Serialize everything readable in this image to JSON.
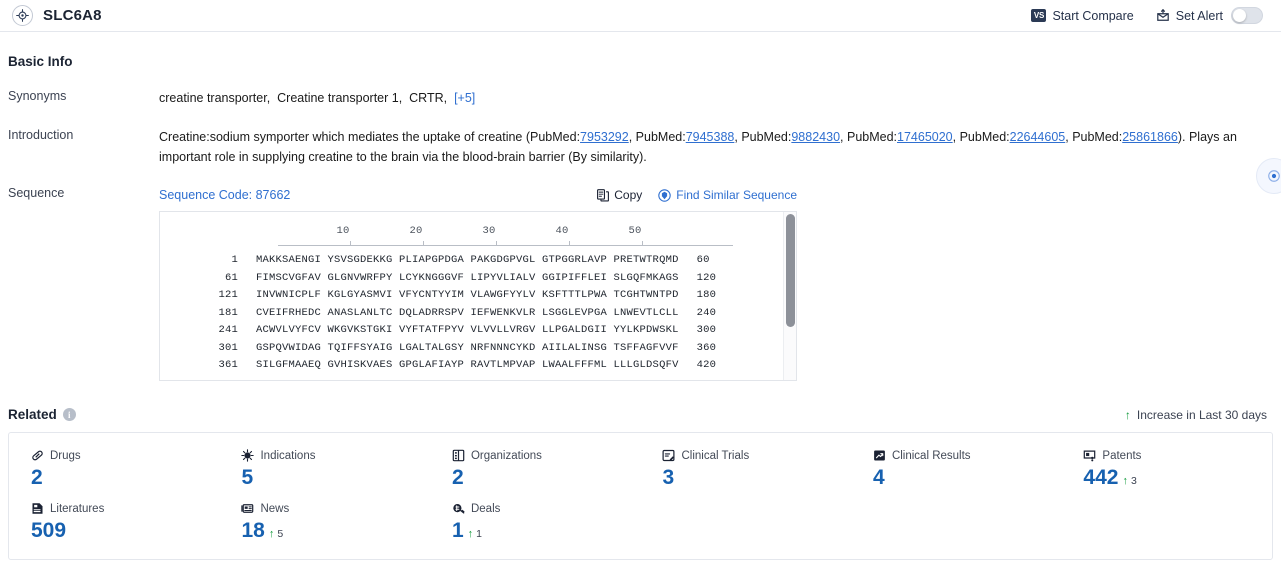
{
  "header": {
    "title": "SLC6A8",
    "logo_icon": "target-crosshair-icon",
    "start_compare": "Start Compare",
    "compare_badge": "VS",
    "set_alert": "Set Alert"
  },
  "basic_info": {
    "title": "Basic Info",
    "synonyms": {
      "label": "Synonyms",
      "items": [
        "creatine transporter,",
        "Creatine transporter 1,",
        "CRTR,"
      ],
      "more": "[+5]"
    },
    "introduction": {
      "label": "Introduction",
      "text_1": "Creatine:sodium symporter which mediates the uptake of creatine (PubMed:",
      "links": [
        "7953292",
        "7945388",
        "9882430",
        "17465020",
        "22644605",
        "25861866"
      ],
      "separator": ", PubMed:",
      "text_2": "). Plays an important role in supplying creatine to the brain via the blood-brain barrier (By similarity)."
    },
    "sequence": {
      "label": "Sequence",
      "code_label": "Sequence Code: 87662",
      "copy_label": "Copy",
      "find_similar_label": "Find Similar Sequence",
      "ruler_ticks": [
        10,
        20,
        30,
        40,
        50
      ],
      "rows": [
        {
          "start": "1",
          "blocks": "MAKKSAENGI YSVSGDEKKG PLIAPGPDGA PAKGDGPVGL GTPGGRLAVP PRETWTRQMD",
          "end": "60"
        },
        {
          "start": "61",
          "blocks": "FIMSCVGFAV GLGNVWRFPY LCYKNGGGVF LIPYVLIALV GGIPIFFLEI SLGQFMKAGS",
          "end": "120"
        },
        {
          "start": "121",
          "blocks": "INVWNICPLF KGLGYASMVI VFYCNTYYIM VLAWGFYYLV KSFTTTLPWA TCGHTWNTPD",
          "end": "180"
        },
        {
          "start": "181",
          "blocks": "CVEIFRHEDC ANASLANLTC DQLADRRSPV IEFWENKVLR LSGGLEVPGA LNWEVTLCLL",
          "end": "240"
        },
        {
          "start": "241",
          "blocks": "ACWVLVYFCV WKGVKSTGKI VYFTATFPYV VLVVLLVRGV LLPGALDGII YYLKPDWSKL",
          "end": "300"
        },
        {
          "start": "301",
          "blocks": "GSPQVWIDAG TQIFFSYAIG LGALTALGSY NRFNNNCYKD AIILALINSG TSFFAGFVVF",
          "end": "360"
        },
        {
          "start": "361",
          "blocks": "SILGFMAAEQ GVHISKVAES GPGLAFIAYP RAVTLMPVAP LWAALFFFML LLLGLDSQFV",
          "end": "420"
        }
      ]
    }
  },
  "related": {
    "title": "Related",
    "info_icon": "info-icon",
    "increase_note": "Increase in Last 30 days",
    "cards": [
      {
        "label": "Drugs",
        "icon": "pill-icon",
        "value": "2",
        "delta": ""
      },
      {
        "label": "Indications",
        "icon": "virus-icon",
        "value": "5",
        "delta": ""
      },
      {
        "label": "Organizations",
        "icon": "building-icon",
        "value": "2",
        "delta": ""
      },
      {
        "label": "Clinical Trials",
        "icon": "clinical-trial-icon",
        "value": "3",
        "delta": ""
      },
      {
        "label": "Clinical Results",
        "icon": "clinical-result-icon",
        "value": "4",
        "delta": ""
      },
      {
        "label": "Patents",
        "icon": "patent-icon",
        "value": "442",
        "delta": "3"
      },
      {
        "label": "Literatures",
        "icon": "literature-icon",
        "value": "509",
        "delta": ""
      },
      {
        "label": "News",
        "icon": "news-icon",
        "value": "18",
        "delta": "5"
      },
      {
        "label": "Deals",
        "icon": "deal-icon",
        "value": "1",
        "delta": "1"
      }
    ]
  },
  "colors": {
    "accent_blue": "#2f6fd0",
    "value_blue": "#1761b0",
    "increase_green": "#159c3e",
    "border": "#e4e7ed"
  }
}
